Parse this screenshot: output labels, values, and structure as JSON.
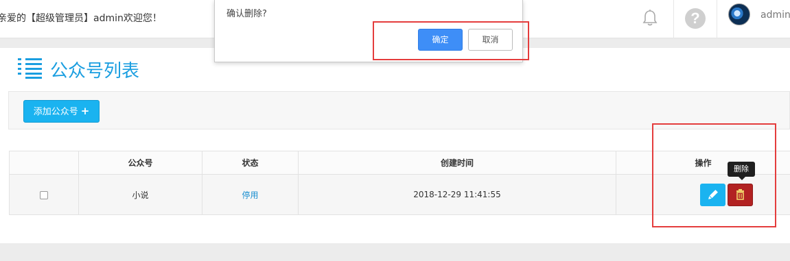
{
  "header": {
    "welcome_text": "亲爱的【超级管理员】admin欢迎您！",
    "user_name": "admin",
    "help_glyph": "?",
    "icons": [
      "bell-icon",
      "help-icon",
      "avatar"
    ]
  },
  "page": {
    "title": "公众号列表",
    "title_icon": "list-icon",
    "add_button_label": "添加公众号",
    "add_button_icon": "+"
  },
  "table": {
    "columns": [
      "",
      "公众号",
      "状态",
      "创建时间",
      "操作"
    ],
    "rows": [
      {
        "account": "小说",
        "status": "停用",
        "created_at": "2018-12-29 11:41:55",
        "actions": [
          "pencil-icon",
          "trash-icon"
        ]
      }
    ]
  },
  "tooltip": {
    "text": "删除"
  },
  "dialog": {
    "message": "确认删除?",
    "ok_label": "确定",
    "cancel_label": "取消"
  },
  "colors": {
    "accent": "#1ab3f0",
    "title_blue": "#1a9ee0",
    "danger": "#b22222",
    "dialog_primary": "#3e8ef7",
    "annotation_red": "#e43c3c"
  }
}
